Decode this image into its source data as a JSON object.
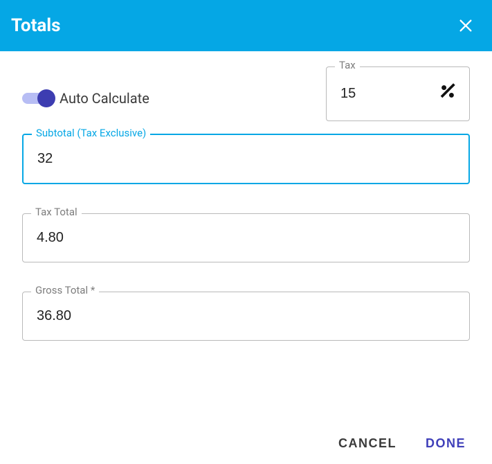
{
  "header": {
    "title": "Totals"
  },
  "auto_calculate": {
    "label": "Auto Calculate",
    "on": true
  },
  "tax": {
    "label": "Tax",
    "value": "15"
  },
  "subtotal": {
    "label": "Subtotal (Tax Exclusive)",
    "value": "32"
  },
  "tax_total": {
    "label": "Tax Total",
    "value": "4.80"
  },
  "gross_total": {
    "label": "Gross Total *",
    "value": "36.80"
  },
  "footer": {
    "cancel": "CANCEL",
    "done": "DONE"
  }
}
